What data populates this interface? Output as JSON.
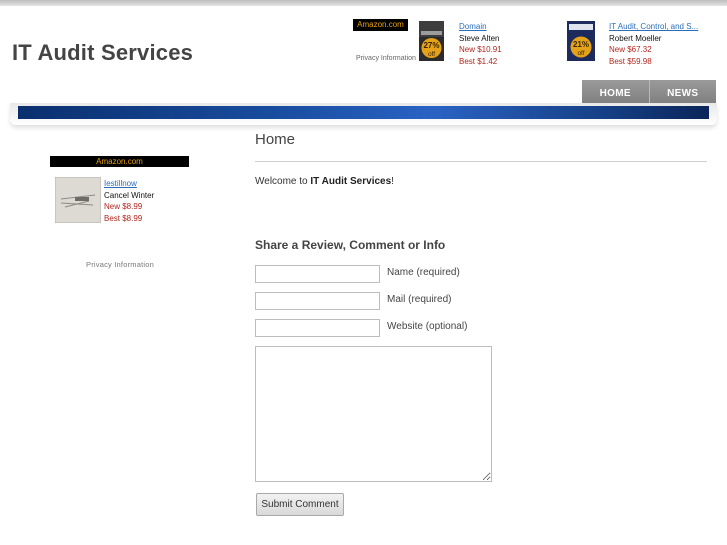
{
  "site": {
    "title": "IT Audit Services"
  },
  "header_widget": {
    "badge": "Amazon.com",
    "privacy": "Privacy Information",
    "products": [
      {
        "title": "Domain",
        "author": "Steve Alten",
        "new_price": "New $10.91",
        "best_price": "Best $1.42",
        "discount": "27%",
        "discount_suffix": "off"
      },
      {
        "title": "IT Audit, Control, and S...",
        "author": "Robert Moeller",
        "new_price": "New $67.32",
        "best_price": "Best $59.98",
        "discount": "21%",
        "discount_suffix": "off"
      }
    ]
  },
  "nav": {
    "items": [
      {
        "label": "HOME"
      },
      {
        "label": "NEWS"
      }
    ]
  },
  "sidebar_widget": {
    "badge": "Amazon.com",
    "product": {
      "title": "Iestillnow",
      "subtitle": "Cancel Winter",
      "new_price": "New $8.99",
      "best_price": "Best $8.99"
    },
    "privacy": "Privacy Information"
  },
  "main": {
    "page_title": "Home",
    "welcome_prefix": "Welcome to ",
    "welcome_site": "IT Audit Services",
    "welcome_suffix": "!",
    "form": {
      "heading": "Share a Review, Comment or Info",
      "name_label": "Name (required)",
      "mail_label": "Mail (required)",
      "website_label": "Website (optional)",
      "name_value": "",
      "mail_value": "",
      "website_value": "",
      "comment_value": "",
      "submit_label": "Submit Comment"
    }
  },
  "colors": {
    "banner": "#1a4fa3",
    "price": "#b3261e",
    "link": "#2a6ebb",
    "badge_text": "#e8a000",
    "nav": "#8a8a8a"
  }
}
